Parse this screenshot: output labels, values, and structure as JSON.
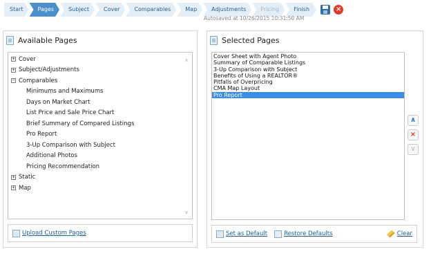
{
  "wizard": {
    "steps": [
      {
        "label": "Start",
        "state": "done"
      },
      {
        "label": "Pages",
        "state": "active"
      },
      {
        "label": "Subject",
        "state": "done"
      },
      {
        "label": "Cover",
        "state": "done"
      },
      {
        "label": "Comparables",
        "state": "done"
      },
      {
        "label": "Map",
        "state": "done"
      },
      {
        "label": "Adjustments",
        "state": "done"
      },
      {
        "label": "Pricing",
        "state": "disabled"
      },
      {
        "label": "Finish",
        "state": "done"
      }
    ],
    "save_icon": "save-icon",
    "cancel_icon": "cancel-icon",
    "autosave": "Autosaved at 10/26/2015 10:31:50 AM"
  },
  "available": {
    "title": "Available Pages",
    "tree": [
      {
        "label": "Cover",
        "expanded": false
      },
      {
        "label": "Subject/Adjustments",
        "expanded": false
      },
      {
        "label": "Comparables",
        "expanded": true,
        "children": [
          "Minimums and Maximums",
          "Days on Market Chart",
          "List Price and Sale Price Chart",
          "Brief Summary of Compared Listings",
          "Pro Report",
          "3-Up Comparison with Subject",
          "Additional Photos",
          "Pricing Recommendation"
        ]
      },
      {
        "label": "Static",
        "expanded": false
      },
      {
        "label": "Map",
        "expanded": false
      }
    ],
    "upload_label": "Upload Custom Pages"
  },
  "selected": {
    "title": "Selected Pages",
    "items": [
      "Cover Sheet with Agent Photo",
      "Summary of Comparable Listings",
      "3-Up Comparison with Subject",
      "Benefits of Using a REALTOR®",
      "Pitfalls of Overpricing",
      "CMA Map Layout",
      "Pro Report"
    ],
    "selected_index": 6,
    "set_default_label": "Set as Default",
    "restore_label": "Restore Defaults",
    "clear_label": "Clear"
  },
  "colors": {
    "accent": "#4c8fcb",
    "selection": "#3a8ee6",
    "link": "#1d5e9c"
  }
}
